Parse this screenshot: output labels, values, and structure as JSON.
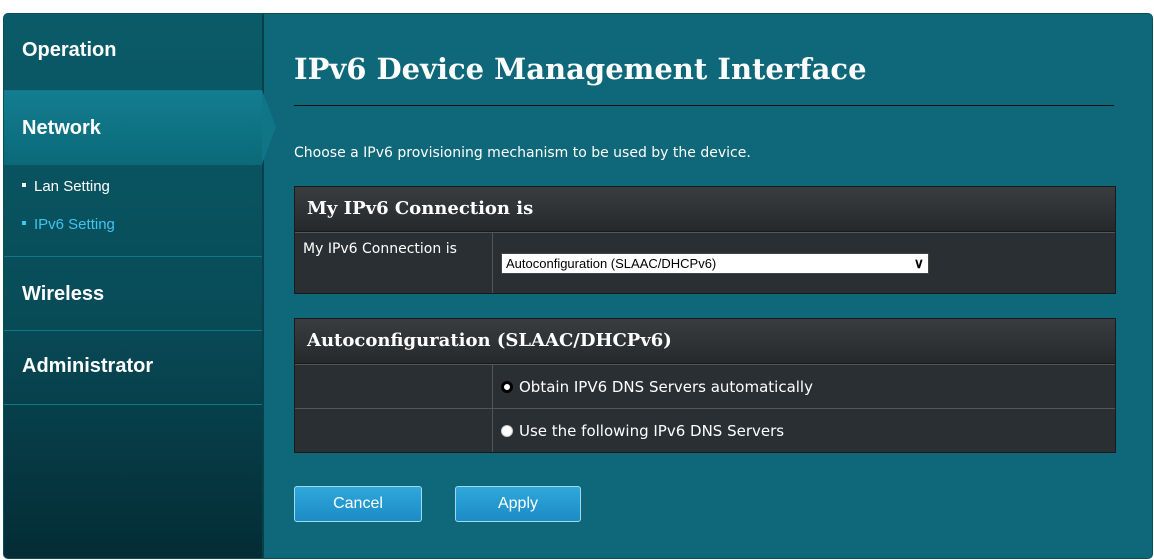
{
  "sidebar": {
    "sections": [
      {
        "label": "Operation"
      },
      {
        "label": "Network",
        "subitems": [
          {
            "label": "Lan Setting"
          },
          {
            "label": "IPv6 Setting"
          }
        ]
      },
      {
        "label": "Wireless"
      },
      {
        "label": "Administrator"
      }
    ]
  },
  "main": {
    "title": "IPv6 Device Management Interface",
    "description": "Choose a IPv6 provisioning mechanism to be used by the device.",
    "connection_panel": {
      "header": "My IPv6 Connection is",
      "label": "My IPv6 Connection is",
      "selected": "Autoconfiguration (SLAAC/DHCPv6)"
    },
    "auto_panel": {
      "header": "Autoconfiguration (SLAAC/DHCPv6)",
      "options": [
        {
          "label": "Obtain IPV6 DNS Servers automatically",
          "checked": true
        },
        {
          "label": "Use the following IPv6 DNS Servers",
          "checked": false
        }
      ]
    },
    "buttons": {
      "cancel": "Cancel",
      "apply": "Apply"
    }
  },
  "colors": {
    "panel_bg": "#0e6879",
    "active_subitem": "#3ec5f0",
    "button": "#2fa8dc"
  }
}
